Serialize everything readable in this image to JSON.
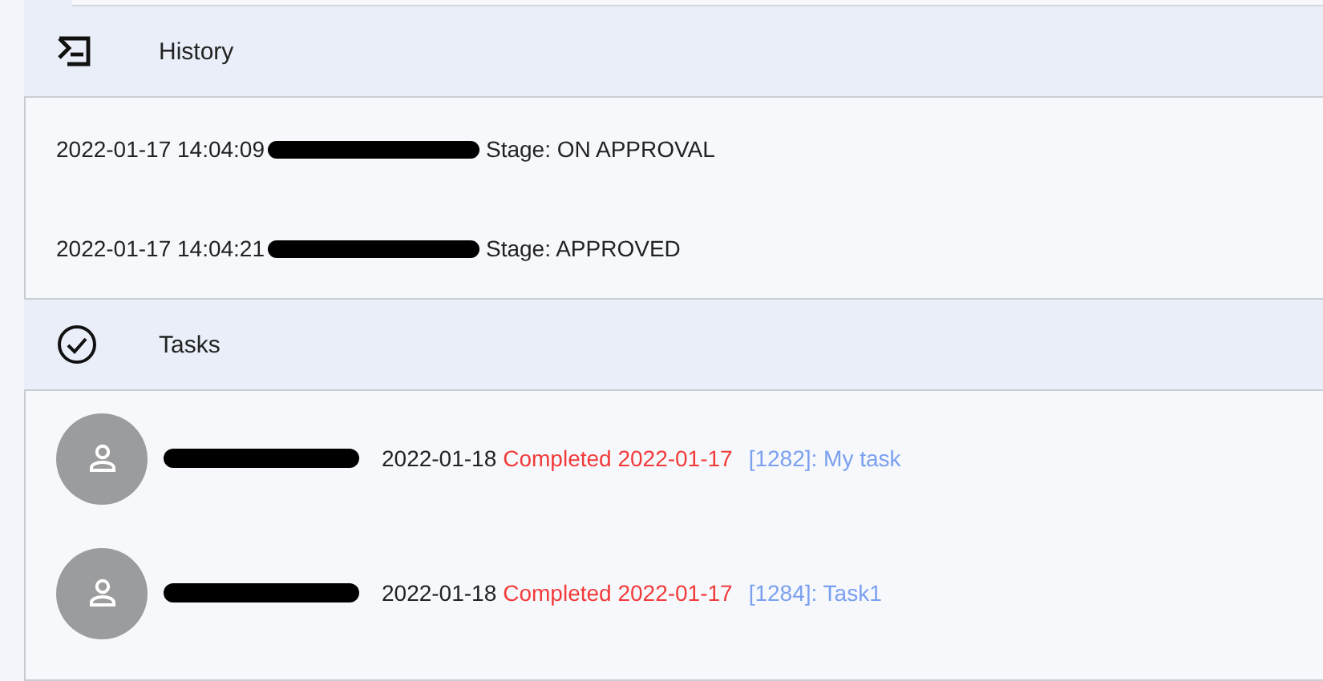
{
  "sections": [
    {
      "kind": "history",
      "title": "History",
      "entries": [
        {
          "time": "2022-01-17 14:04:09",
          "stage": "Stage: ON APPROVAL"
        },
        {
          "time": "2022-01-17 14:04:21",
          "stage": "Stage: APPROVED"
        }
      ]
    },
    {
      "kind": "tasks",
      "title": "Tasks",
      "entries": [
        {
          "due": "2022-01-18",
          "status": "Completed 2022-01-17",
          "task": "[1282]: My task"
        },
        {
          "due": "2022-01-18",
          "status": "Completed 2022-01-17",
          "task": "[1284]: Task1"
        }
      ]
    }
  ]
}
